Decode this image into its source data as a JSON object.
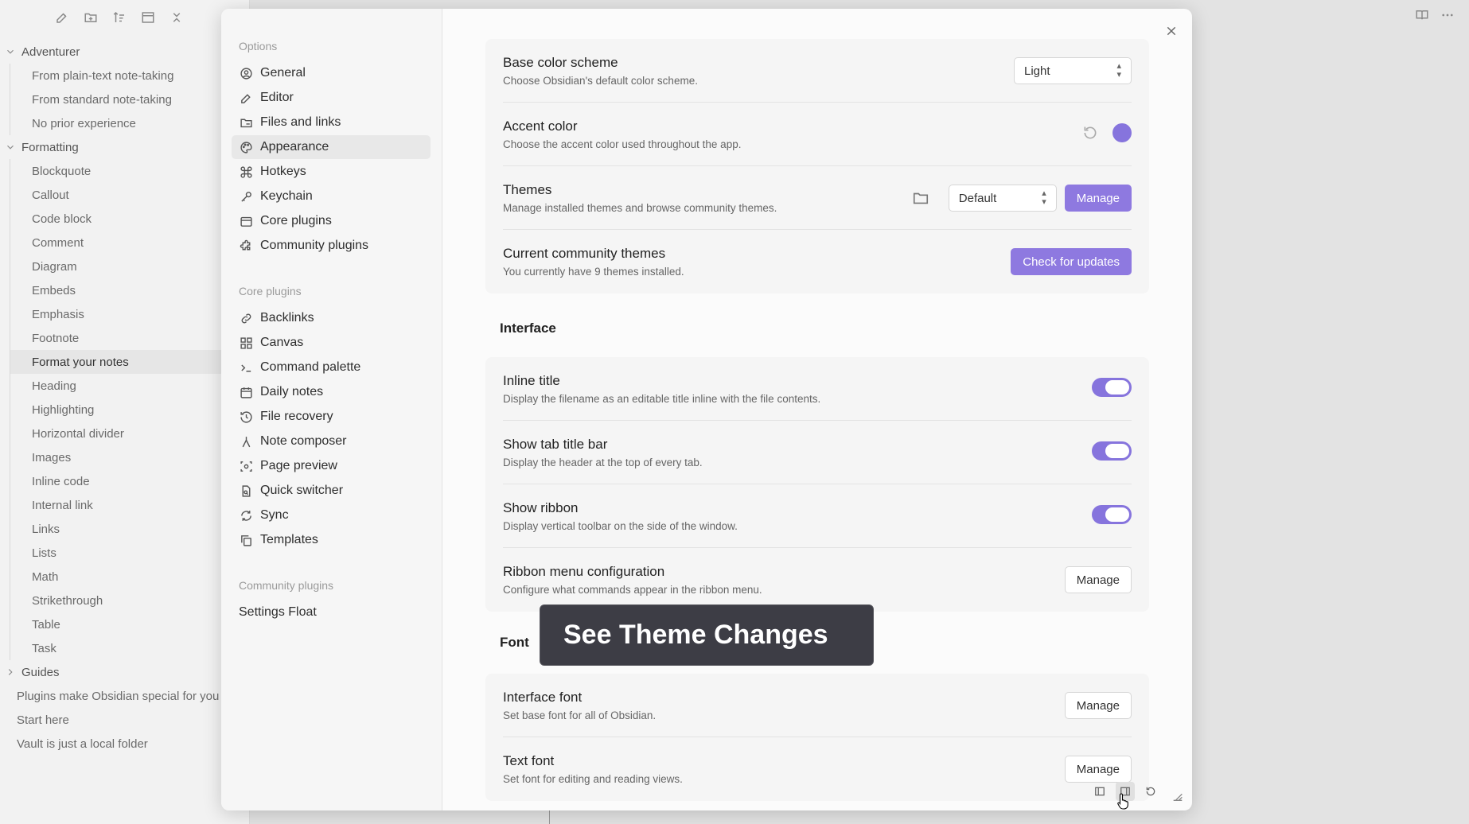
{
  "explorer": {
    "toolbar": [
      "new-note-icon",
      "new-folder-icon",
      "sort-icon",
      "collapse-icon",
      "close-all-icon"
    ],
    "folders": [
      {
        "label": "Adventurer",
        "items": [
          "From plain-text note-taking",
          "From standard note-taking",
          "No prior experience"
        ]
      },
      {
        "label": "Formatting",
        "items": [
          "Blockquote",
          "Callout",
          "Code block",
          "Comment",
          "Diagram",
          "Embeds",
          "Emphasis",
          "Footnote",
          "Format your notes",
          "Heading",
          "Highlighting",
          "Horizontal divider",
          "Images",
          "Inline code",
          "Internal link",
          "Links",
          "Lists",
          "Math",
          "Strikethrough",
          "Table",
          "Task"
        ]
      },
      {
        "label": "Guides",
        "items": []
      }
    ],
    "root_items": [
      "Plugins make Obsidian special for you",
      "Start here",
      "Vault is just a local folder"
    ],
    "active_item": "Format your notes"
  },
  "settings": {
    "nav": {
      "options_label": "Options",
      "options": [
        "General",
        "Editor",
        "Files and links",
        "Appearance",
        "Hotkeys",
        "Keychain",
        "Core plugins",
        "Community plugins"
      ],
      "active": "Appearance",
      "core_label": "Core plugins",
      "core": [
        "Backlinks",
        "Canvas",
        "Command palette",
        "Daily notes",
        "File recovery",
        "Note composer",
        "Page preview",
        "Quick switcher",
        "Sync",
        "Templates"
      ],
      "community_label": "Community plugins",
      "community": [
        "Settings Float"
      ]
    },
    "appearance": {
      "base_scheme": {
        "title": "Base color scheme",
        "desc": "Choose Obsidian's default color scheme.",
        "value": "Light"
      },
      "accent": {
        "title": "Accent color",
        "desc": "Choose the accent color used throughout the app.",
        "color": "#8674dd"
      },
      "themes": {
        "title": "Themes",
        "desc": "Manage installed themes and browse community themes.",
        "value": "Default",
        "button": "Manage"
      },
      "community_themes": {
        "title": "Current community themes",
        "desc": "You currently have 9 themes installed.",
        "button": "Check for updates"
      }
    },
    "interface": {
      "heading": "Interface",
      "inline_title": {
        "title": "Inline title",
        "desc": "Display the filename as an editable title inline with the file contents.",
        "on": true
      },
      "tab_title_bar": {
        "title": "Show tab title bar",
        "desc": "Display the header at the top of every tab.",
        "on": true
      },
      "ribbon": {
        "title": "Show ribbon",
        "desc": "Display vertical toolbar on the side of the window.",
        "on": true
      },
      "ribbon_menu": {
        "title": "Ribbon menu configuration",
        "desc": "Configure what commands appear in the ribbon menu.",
        "button": "Manage"
      }
    },
    "font": {
      "heading": "Font",
      "interface_font": {
        "title": "Interface font",
        "desc": "Set base font for all of Obsidian.",
        "button": "Manage"
      },
      "text_font": {
        "title": "Text font",
        "desc": "Set font for editing and reading views.",
        "button": "Manage"
      }
    }
  },
  "overlay": {
    "text": "See Theme Changes"
  }
}
